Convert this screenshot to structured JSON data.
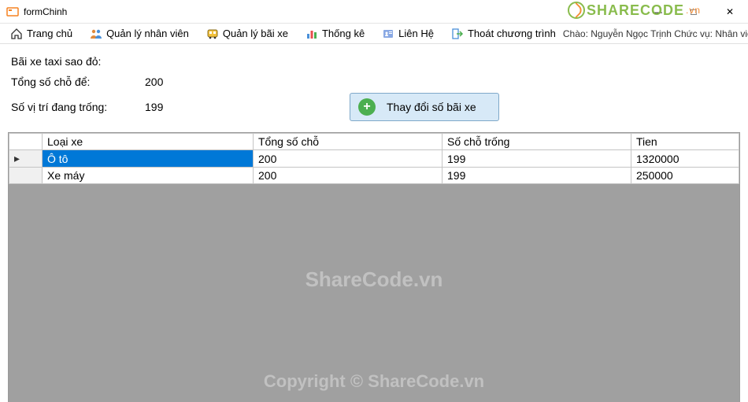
{
  "window": {
    "title": "formChinh"
  },
  "menu": {
    "home": "Trang chủ",
    "staff": "Quản lý nhân viên",
    "parking": "Quản lý bãi xe",
    "stats": "Thống kê",
    "contact": "Liên Hệ",
    "exit": "Thoát chương trình",
    "greeting": "Chào: Nguyễn Ngọc Trịnh Chức vụ: Nhân viên quản lý"
  },
  "info": {
    "title": "Bãi xe taxi sao đỏ:",
    "total_label": "Tổng số chỗ để:",
    "total_value": "200",
    "empty_label": "Số vị trí đang trống:",
    "empty_value": "199",
    "change_btn": "Thay đổi số bãi xe"
  },
  "grid": {
    "headers": {
      "type": "Loại xe",
      "total": "Tổng số chỗ",
      "empty": "Số chỗ trống",
      "money": "Tien"
    },
    "rows": [
      {
        "type": "Ô tô",
        "total": "200",
        "empty": "199",
        "money": "1320000"
      },
      {
        "type": "Xe máy",
        "total": "200",
        "empty": "199",
        "money": "250000"
      }
    ]
  },
  "watermark": {
    "brand": "SHARECODE",
    "vn": ".vn",
    "center1": "ShareCode.vn",
    "center2": "Copyright © ShareCode.vn"
  }
}
